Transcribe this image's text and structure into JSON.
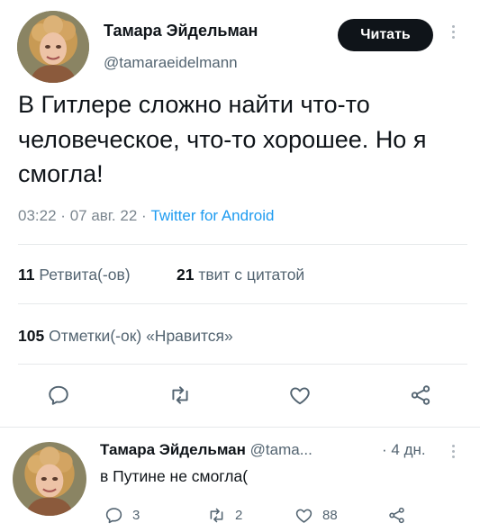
{
  "tweet": {
    "author_name": "Тамара Эйдельман",
    "author_handle": "@tamaraeidelmann",
    "follow_label": "Читать",
    "text": "В Гитлере сложно найти что-то человеческое, что-то хорошее. Но я смогла!",
    "time": "03:22",
    "date": "07 авг. 22",
    "separator": "·",
    "source": "Twitter for Android"
  },
  "stats": {
    "retweets_count": "11",
    "retweets_label": "Ретвита(-ов)",
    "quotes_count": "21",
    "quotes_label": "твит с цитатой",
    "likes_count": "105",
    "likes_label": "Отметки(-ок) «Нравится»"
  },
  "actions": [
    "reply-icon",
    "retweet-icon",
    "like-icon",
    "share-icon"
  ],
  "reply": {
    "author_name": "Тамара Эйдельман",
    "author_handle_truncated": "@tama...",
    "separator": "·",
    "age": "4 дн.",
    "text": "в Путине не смогла(",
    "reply_count": "3",
    "retweet_count": "2",
    "like_count": "88"
  },
  "colors": {
    "text": "#0f1419",
    "secondary": "#536471",
    "link": "#1d9bf0",
    "button": "#0f1419",
    "divider": "#e6e9eb"
  }
}
